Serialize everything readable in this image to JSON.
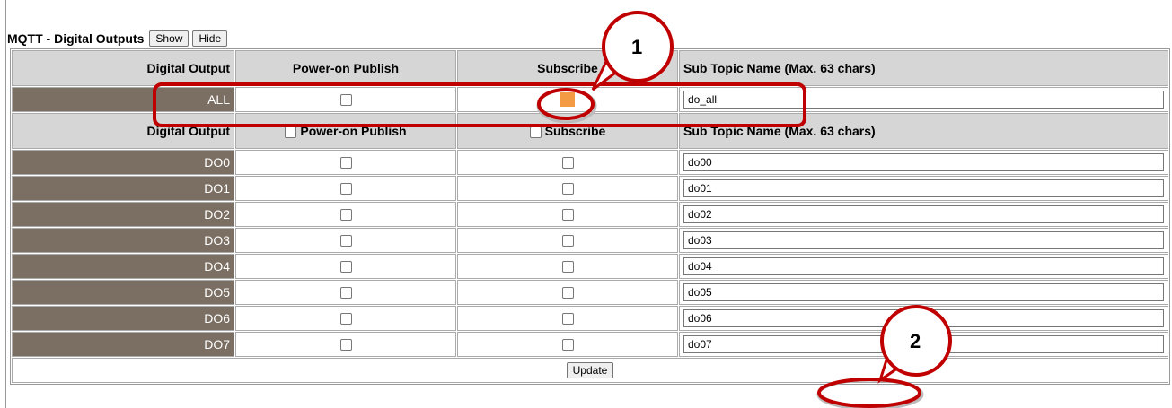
{
  "panel": {
    "title": "MQTT - Digital Outputs",
    "show_label": "Show",
    "hide_label": "Hide"
  },
  "headers": {
    "digital_output": "Digital Output",
    "power_on_publish": "Power-on Publish",
    "subscribe": "Subscribe",
    "sub_topic": "Sub Topic Name (Max. 63 chars)"
  },
  "all_row": {
    "label": "ALL",
    "power_on_publish": false,
    "subscribe": true,
    "topic": "do_all"
  },
  "rows": [
    {
      "label": "DO0",
      "topic": "do00"
    },
    {
      "label": "DO1",
      "topic": "do01"
    },
    {
      "label": "DO2",
      "topic": "do02"
    },
    {
      "label": "DO3",
      "topic": "do03"
    },
    {
      "label": "DO4",
      "topic": "do04"
    },
    {
      "label": "DO5",
      "topic": "do05"
    },
    {
      "label": "DO6",
      "topic": "do06"
    },
    {
      "label": "DO7",
      "topic": "do07"
    }
  ],
  "update_label": "Update",
  "callouts": [
    "1",
    "2"
  ],
  "colors": {
    "label_cell": "#7b6f63",
    "header_cell": "#d6d6d6",
    "callout": "#c00000",
    "checked": "#f39a45"
  }
}
